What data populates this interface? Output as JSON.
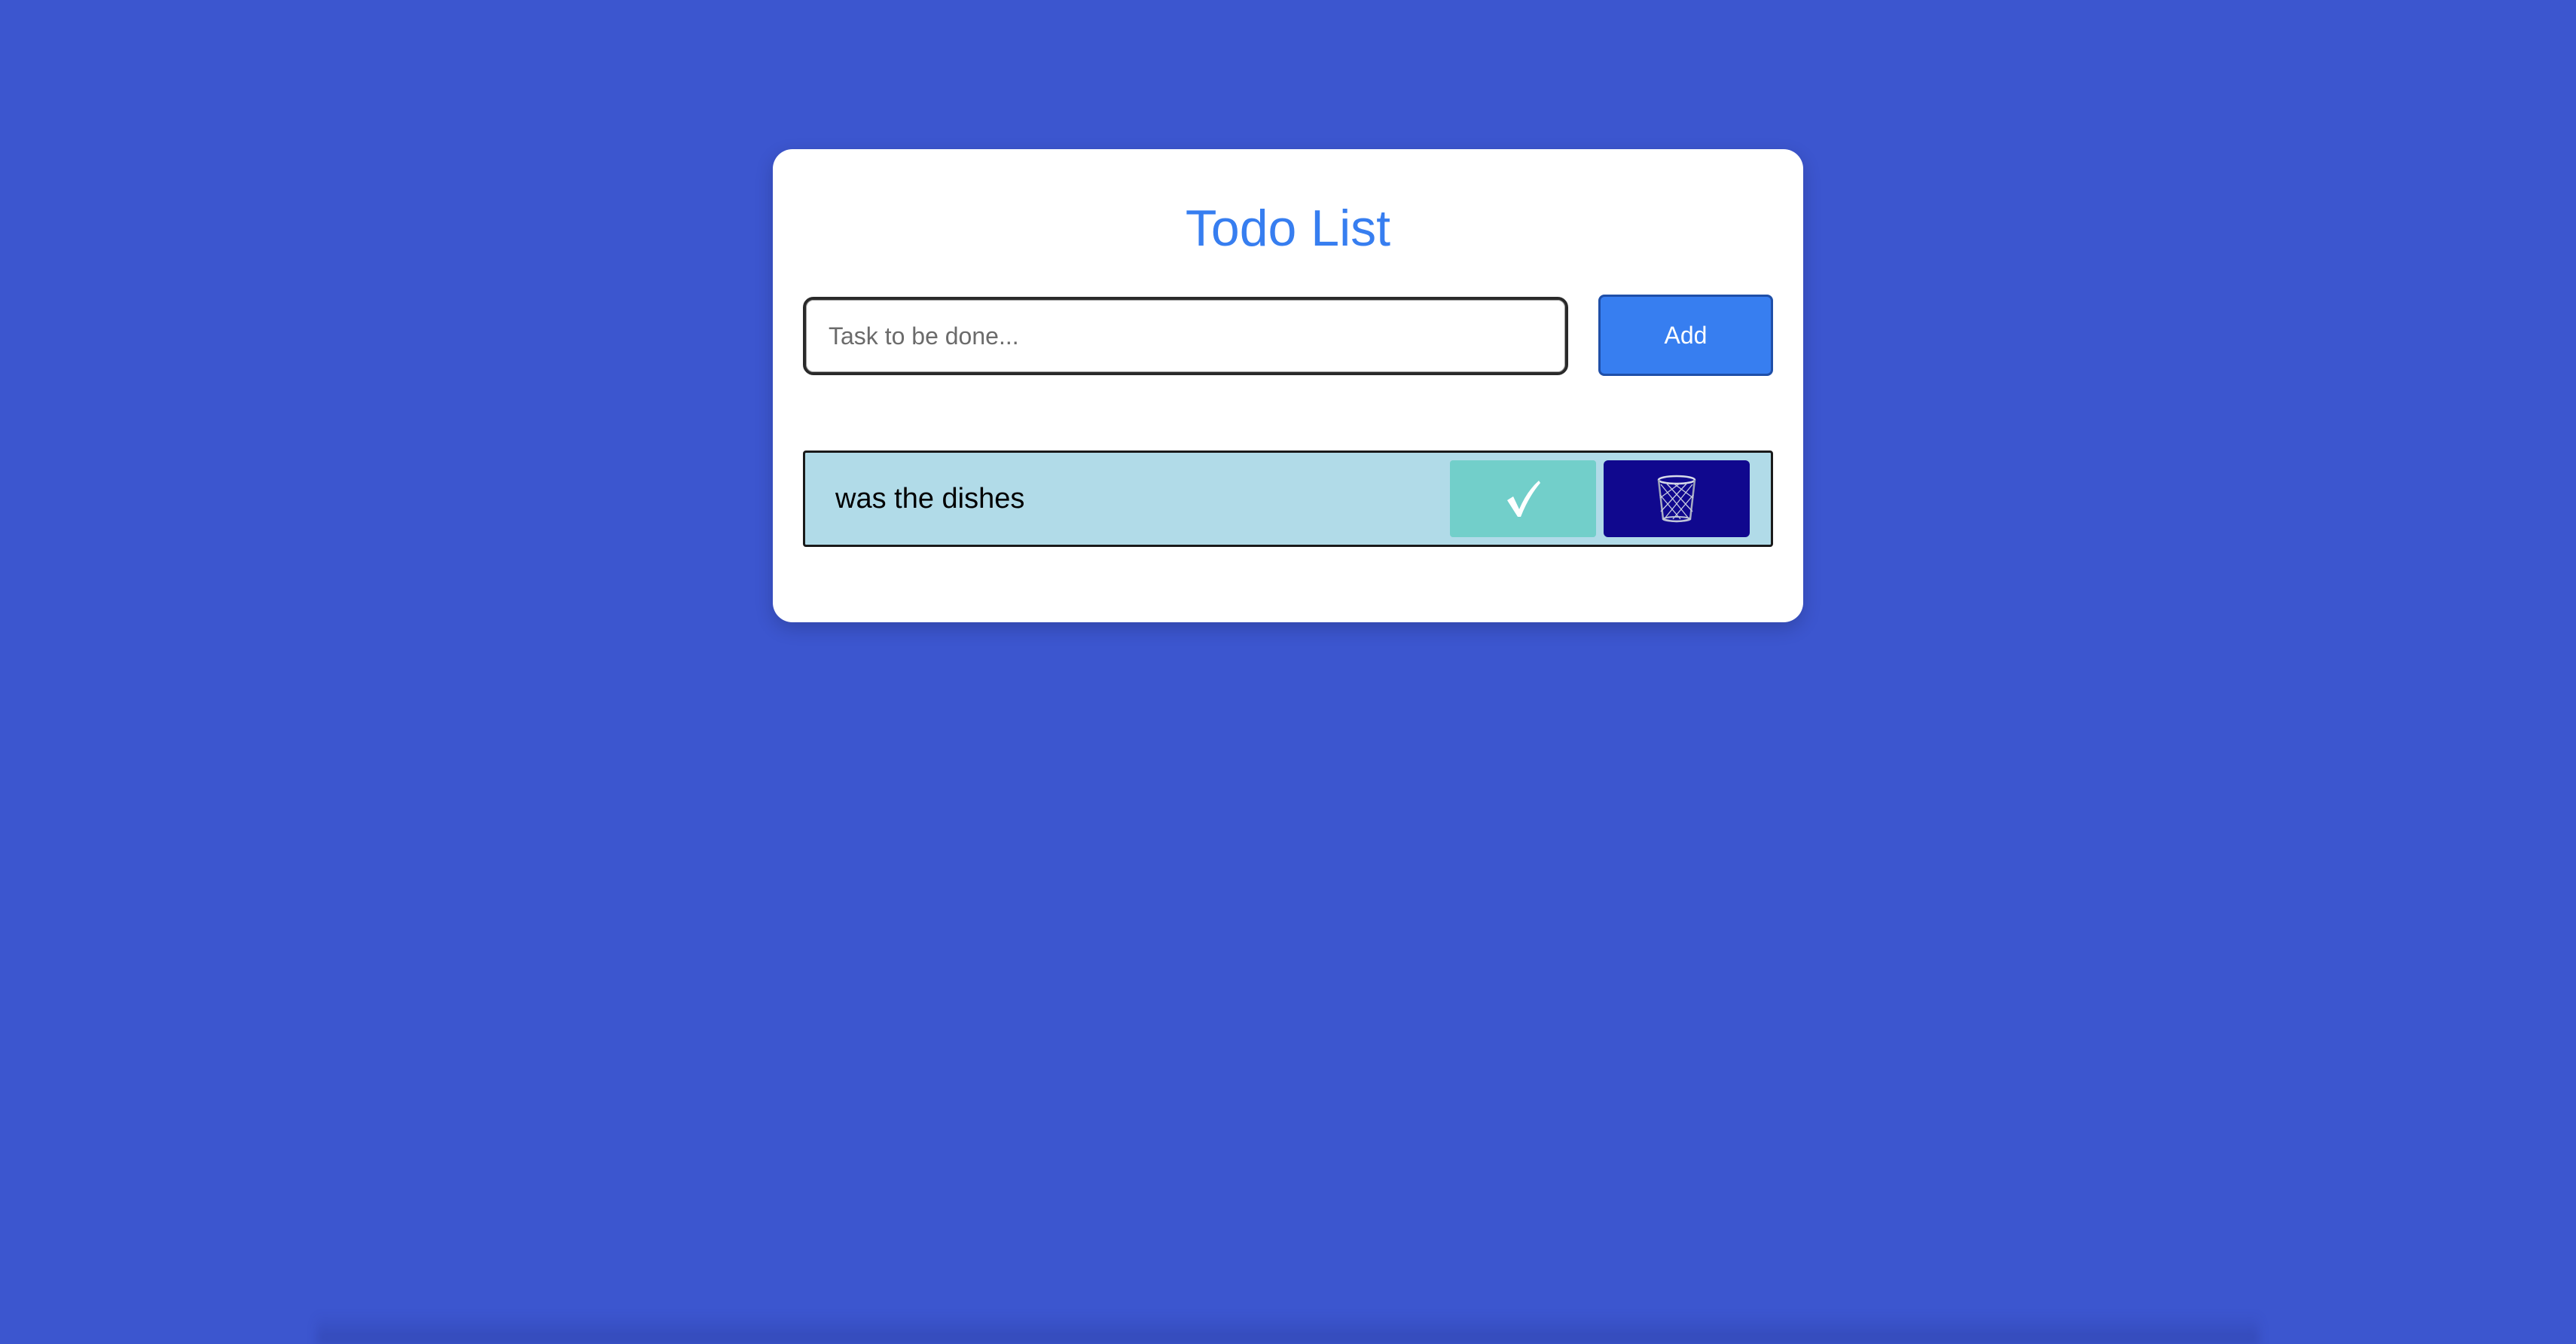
{
  "app": {
    "title": "Todo List"
  },
  "form": {
    "input_value": "",
    "input_placeholder": "Task to be done...",
    "add_label": "Add"
  },
  "todos": [
    {
      "text": "was the dishes",
      "complete_icon": "checkmark-icon",
      "delete_icon": "trash-icon"
    }
  ],
  "colors": {
    "background": "#3c56cf",
    "card": "#ffffff",
    "accent": "#377ef0",
    "item_background": "#b1dbe8",
    "complete_button": "#72cfca",
    "delete_button": "#10088e"
  }
}
